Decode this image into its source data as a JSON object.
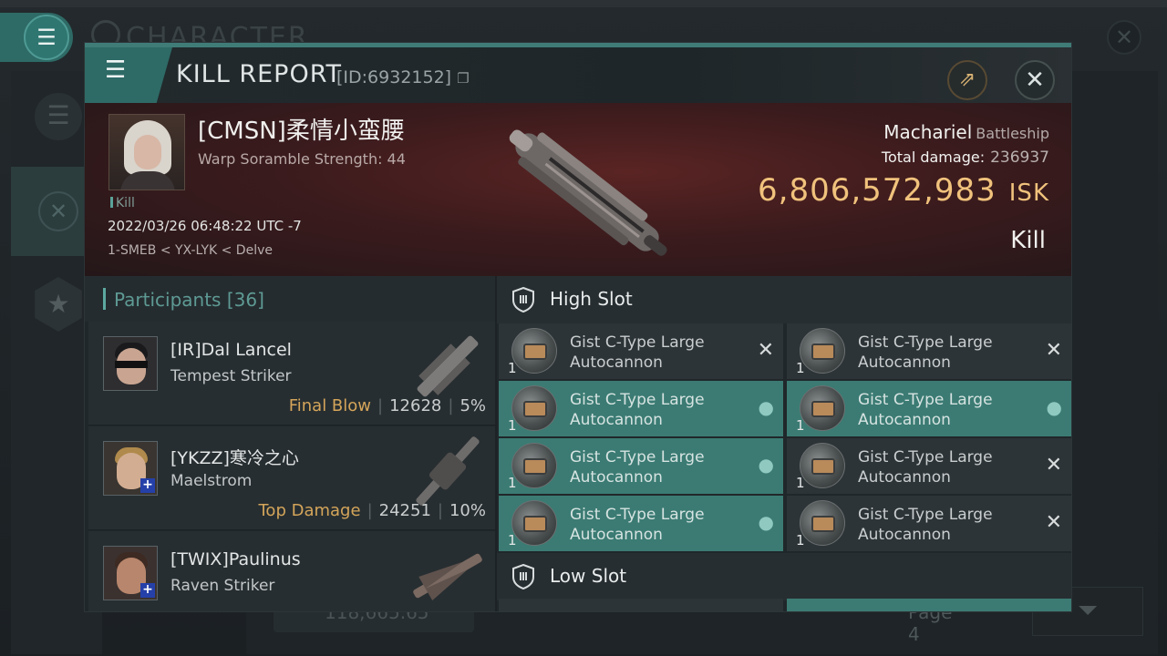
{
  "background": {
    "title": "CHARACTER",
    "bottom_value": "118,665.65",
    "page_label": "Page 4"
  },
  "modal": {
    "title": "KILL REPORT",
    "id_label": "[ID:6932152]",
    "victim": {
      "name": "[CMSN]柔情小蛮腰",
      "subtitle": "Warp Soramble Strength: 44",
      "tag": "Kill",
      "datetime": "2022/03/26 06:48:22 UTC -7",
      "location": "1-SMEB < YX-LYK < Delve"
    },
    "ship": {
      "name": "Machariel",
      "class": "Battleship",
      "total_damage_label": "Total damage:",
      "total_damage": "236937",
      "isk_value": "6,806,572,983",
      "isk_unit": "ISK",
      "result": "Kill"
    },
    "participants": {
      "label": "Participants",
      "count": "[36]",
      "items": [
        {
          "name": "[IR]Dal Lancel",
          "ship": "Tempest Striker",
          "tag": "Final Blow",
          "damage": "12628",
          "percent": "5%"
        },
        {
          "name": "[YKZZ]寒冷之心",
          "ship": "Maelstrom",
          "tag": "Top Damage",
          "damage": "24251",
          "percent": "10%"
        },
        {
          "name": "[TWIX]Paulinus",
          "ship": "Raven Striker",
          "tag": "",
          "damage": "",
          "percent": ""
        }
      ]
    },
    "fitting": {
      "high_slot_label": "High Slot",
      "low_slot_label": "Low Slot",
      "modules": [
        {
          "qty": "1",
          "name": "Gist C-Type Large Autocannon",
          "state": "destroyed"
        },
        {
          "qty": "1",
          "name": "Gist C-Type Large Autocannon",
          "state": "destroyed"
        },
        {
          "qty": "1",
          "name": "Gist C-Type Large Autocannon",
          "state": "dropped"
        },
        {
          "qty": "1",
          "name": "Gist C-Type Large Autocannon",
          "state": "dropped"
        },
        {
          "qty": "1",
          "name": "Gist C-Type Large Autocannon",
          "state": "dropped"
        },
        {
          "qty": "1",
          "name": "Gist C-Type Large Autocannon",
          "state": "destroyed"
        },
        {
          "qty": "1",
          "name": "Gist C-Type Large Autocannon",
          "state": "dropped"
        },
        {
          "qty": "1",
          "name": "Gist C-Type Large Autocannon",
          "state": "destroyed"
        }
      ]
    }
  },
  "colors": {
    "accent": "#3b7b73",
    "isk": "#f0c27c",
    "final_blow": "#d4a55a",
    "banner": "#5a2423"
  },
  "icons": [
    "menu-icon",
    "share-icon",
    "close-icon",
    "shield-slot-icon",
    "pilot-icon",
    "destroyed-icon"
  ]
}
